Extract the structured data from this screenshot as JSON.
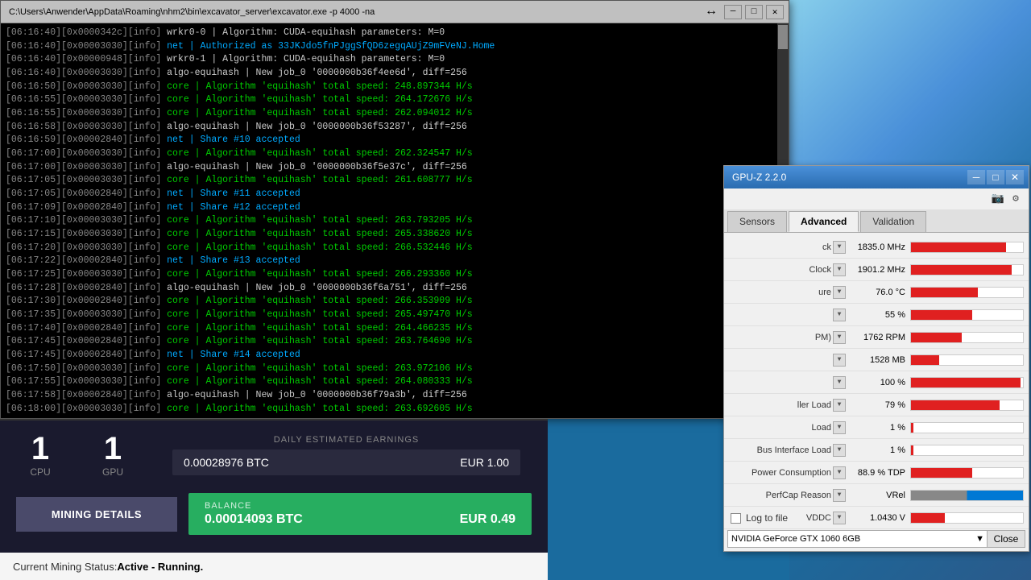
{
  "terminal": {
    "title": "C:\\Users\\Anwender\\AppData\\Roaming\\nhm2\\bin\\excavator_server\\excavator.exe -p 4000 -na",
    "lines": [
      {
        "prefix": "[06:16:40][0x0000342c][info]",
        "content": " wrkr0-0 | Algorithm: CUDA-equihash parameters: M=0",
        "color": "normal"
      },
      {
        "prefix": "[06:16:40][0x00003030][info]",
        "content": " net | Authorized as 33JKJdo5fnPJggSfQD6zegqAUjZ9mFVeNJ.Home",
        "color": "cyan"
      },
      {
        "prefix": "[06:16:40][0x00000948][info]",
        "content": " wrkr0-1 | Algorithm: CUDA-equihash parameters: M=0",
        "color": "normal"
      },
      {
        "prefix": "[06:16:40][0x00003030][info]",
        "content": " algo-equihash | New job_0 '0000000b36f4ee6d', diff=256",
        "color": "normal"
      },
      {
        "prefix": "[06:16:50][0x00003030][info]",
        "content": " core | Algorithm 'equihash' total speed: 248.897344 H/s",
        "color": "green"
      },
      {
        "prefix": "[06:16:55][0x00003030][info]",
        "content": " core | Algorithm 'equihash' total speed: 264.172676 H/s",
        "color": "green"
      },
      {
        "prefix": "[06:16:55][0x00003030][info]",
        "content": " core | Algorithm 'equihash' total speed: 262.094012 H/s",
        "color": "green"
      },
      {
        "prefix": "[06:16:58][0x00003030][info]",
        "content": " algo-equihash | New job_0 '0000000b36f53287', diff=256",
        "color": "normal"
      },
      {
        "prefix": "[06:16:59][0x00002840][info]",
        "content": " net | Share #10 accepted",
        "color": "cyan"
      },
      {
        "prefix": "[06:17:00][0x00003030][info]",
        "content": " core | Algorithm 'equihash' total speed: 262.324547 H/s",
        "color": "green"
      },
      {
        "prefix": "[06:17:00][0x00003030][info]",
        "content": " algo-equihash | New job_0 '0000000b36f5e37c', diff=256",
        "color": "normal"
      },
      {
        "prefix": "[06:17:05][0x00003030][info]",
        "content": " core | Algorithm 'equihash' total speed: 261.608777 H/s",
        "color": "green"
      },
      {
        "prefix": "[06:17:05][0x00002840][info]",
        "content": " net | Share #11 accepted",
        "color": "cyan"
      },
      {
        "prefix": "[06:17:09][0x00002840][info]",
        "content": " net | Share #12 accepted",
        "color": "cyan"
      },
      {
        "prefix": "[06:17:10][0x00003030][info]",
        "content": " core | Algorithm 'equihash' total speed: 263.793205 H/s",
        "color": "green"
      },
      {
        "prefix": "[06:17:15][0x00003030][info]",
        "content": " core | Algorithm 'equihash' total speed: 265.338620 H/s",
        "color": "green"
      },
      {
        "prefix": "[06:17:20][0x00003030][info]",
        "content": " core | Algorithm 'equihash' total speed: 266.532446 H/s",
        "color": "green"
      },
      {
        "prefix": "[06:17:22][0x00002840][info]",
        "content": " net | Share #13 accepted",
        "color": "cyan"
      },
      {
        "prefix": "[06:17:25][0x00003030][info]",
        "content": " core | Algorithm 'equihash' total speed: 266.293360 H/s",
        "color": "green"
      },
      {
        "prefix": "[06:17:28][0x00002840][info]",
        "content": " algo-equihash | New job_0 '0000000b36f6a751', diff=256",
        "color": "normal"
      },
      {
        "prefix": "[06:17:30][0x00002840][info]",
        "content": " core | Algorithm 'equihash' total speed: 266.353909 H/s",
        "color": "green"
      },
      {
        "prefix": "[06:17:35][0x00003030][info]",
        "content": " core | Algorithm 'equihash' total speed: 265.497470 H/s",
        "color": "green"
      },
      {
        "prefix": "[06:17:40][0x00002840][info]",
        "content": " core | Algorithm 'equihash' total speed: 264.466235 H/s",
        "color": "green"
      },
      {
        "prefix": "[06:17:45][0x00002840][info]",
        "content": " core | Algorithm 'equihash' total speed: 263.764690 H/s",
        "color": "green"
      },
      {
        "prefix": "[06:17:45][0x00002840][info]",
        "content": " net | Share #14 accepted",
        "color": "cyan"
      },
      {
        "prefix": "[06:17:50][0x00003030][info]",
        "content": " core | Algorithm 'equihash' total speed: 263.972106 H/s",
        "color": "green"
      },
      {
        "prefix": "[06:17:55][0x00003030][info]",
        "content": " core | Algorithm 'equihash' total speed: 264.080333 H/s",
        "color": "green"
      },
      {
        "prefix": "[06:17:58][0x00002840][info]",
        "content": " algo-equihash | New job_0 '0000000b36f79a3b', diff=256",
        "color": "normal"
      },
      {
        "prefix": "[06:18:00][0x00003030][info]",
        "content": " core | Algorithm 'equihash' total speed: 263.692605 H/s",
        "color": "green"
      }
    ]
  },
  "mining_panel": {
    "cpu_count": "1",
    "cpu_label": "CPU",
    "gpu_count": "1",
    "gpu_label": "GPU",
    "earnings_label": "DAILY ESTIMATED EARNINGS",
    "earnings_btc": "0.00028976 BTC",
    "earnings_eur": "EUR 1.00",
    "balance_label": "BALANCE",
    "balance_btc": "0.00014093 BTC",
    "balance_eur": "EUR 0.49",
    "mining_details_btn": "MINING DETAILS",
    "status_prefix": "Current Mining Status: ",
    "status_text": "Active - Running."
  },
  "gpuz": {
    "title": "GPU-Z 2.2.0",
    "tabs": [
      "Sensors",
      "Advanced",
      "Validation"
    ],
    "active_tab": "Sensors",
    "sensors": [
      {
        "name": "ck",
        "value": "1835.0 MHz",
        "bar_pct": 85,
        "bar_type": "red"
      },
      {
        "name": "Clock",
        "value": "1901.2 MHz",
        "bar_pct": 90,
        "bar_type": "red"
      },
      {
        "name": "ure",
        "value": "76.0 °C",
        "bar_pct": 60,
        "bar_type": "red"
      },
      {
        "name": "",
        "value": "55 %",
        "bar_pct": 55,
        "bar_type": "red"
      },
      {
        "name": "PM)",
        "value": "1762 RPM",
        "bar_pct": 45,
        "bar_type": "red"
      },
      {
        "name": "",
        "value": "1528 MB",
        "bar_pct": 25,
        "bar_type": "red"
      },
      {
        "name": "",
        "value": "100 %",
        "bar_pct": 98,
        "bar_type": "red"
      },
      {
        "name": "ller Load",
        "value": "79 %",
        "bar_pct": 79,
        "bar_type": "red"
      },
      {
        "name": "Load",
        "value": "1 %",
        "bar_pct": 2,
        "bar_type": "red"
      },
      {
        "name": "Bus Interface Load",
        "value": "1 %",
        "bar_pct": 2,
        "bar_type": "red"
      },
      {
        "name": "Power Consumption",
        "value": "88.9 % TDP",
        "bar_pct": 55,
        "bar_type": "red"
      },
      {
        "name": "PerfCap Reason",
        "value": "VRel",
        "bar_pct_gray": 35,
        "bar_pct_blue": 50,
        "bar_type": "mixed"
      },
      {
        "name": "VDDC",
        "value": "1.0430 V",
        "bar_pct": 30,
        "bar_type": "red"
      }
    ],
    "log_to_file": false,
    "gpu_name": "NVIDIA GeForce GTX 1060 6GB",
    "close_btn": "Close"
  }
}
